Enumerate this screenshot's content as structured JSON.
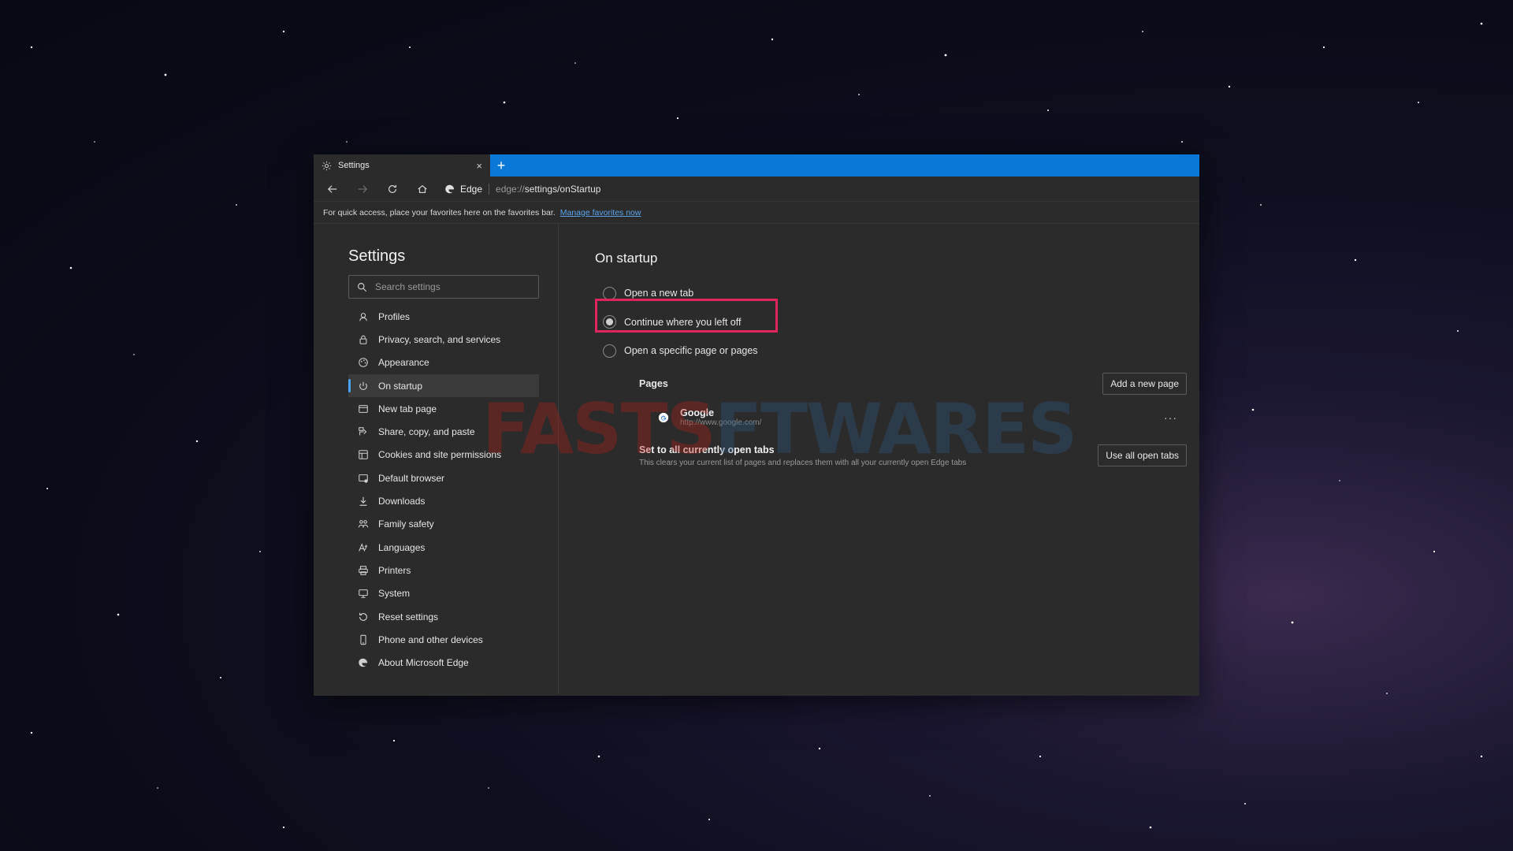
{
  "colors": {
    "accent_blue": "#0a78d6",
    "highlight_red": "#e0245e",
    "link_blue": "#5ba4ec"
  },
  "tab": {
    "title": "Settings",
    "icon": "gear-icon",
    "close_glyph": "×"
  },
  "newtab_glyph": "+",
  "address": {
    "brand": "Edge",
    "url_prefix": "edge://",
    "url_path": "settings/onStartup"
  },
  "favbar": {
    "message": "For quick access, place your favorites here on the favorites bar.",
    "link": "Manage favorites now"
  },
  "sidebar": {
    "title": "Settings",
    "search_placeholder": "Search settings",
    "items": [
      {
        "label": "Profiles",
        "icon": "profile-icon"
      },
      {
        "label": "Privacy, search, and services",
        "icon": "lock-icon"
      },
      {
        "label": "Appearance",
        "icon": "appearance-icon"
      },
      {
        "label": "On startup",
        "icon": "power-icon",
        "active": true
      },
      {
        "label": "New tab page",
        "icon": "newtab-page-icon"
      },
      {
        "label": "Share, copy, and paste",
        "icon": "share-icon"
      },
      {
        "label": "Cookies and site permissions",
        "icon": "cookies-icon"
      },
      {
        "label": "Default browser",
        "icon": "default-browser-icon"
      },
      {
        "label": "Downloads",
        "icon": "download-icon"
      },
      {
        "label": "Family safety",
        "icon": "family-icon"
      },
      {
        "label": "Languages",
        "icon": "languages-icon"
      },
      {
        "label": "Printers",
        "icon": "printer-icon"
      },
      {
        "label": "System",
        "icon": "system-icon"
      },
      {
        "label": "Reset settings",
        "icon": "reset-icon"
      },
      {
        "label": "Phone and other devices",
        "icon": "phone-icon"
      },
      {
        "label": "About Microsoft Edge",
        "icon": "edge-icon"
      }
    ]
  },
  "main": {
    "title": "On startup",
    "options": [
      {
        "label": "Open a new tab",
        "checked": false
      },
      {
        "label": "Continue where you left off",
        "checked": true
      },
      {
        "label": "Open a specific page or pages",
        "checked": false
      }
    ],
    "pages_label": "Pages",
    "add_page_button": "Add a new page",
    "page_entry": {
      "name": "Google",
      "url": "http://www.google.com/",
      "more_glyph": "···"
    },
    "open_tabs": {
      "title": "Set to all currently open tabs",
      "description": "This clears your current list of pages and replaces them with all your currently open Edge tabs",
      "button": "Use all open tabs"
    }
  },
  "watermark": {
    "part1": "FASTS",
    "part2": "FTWARES"
  }
}
